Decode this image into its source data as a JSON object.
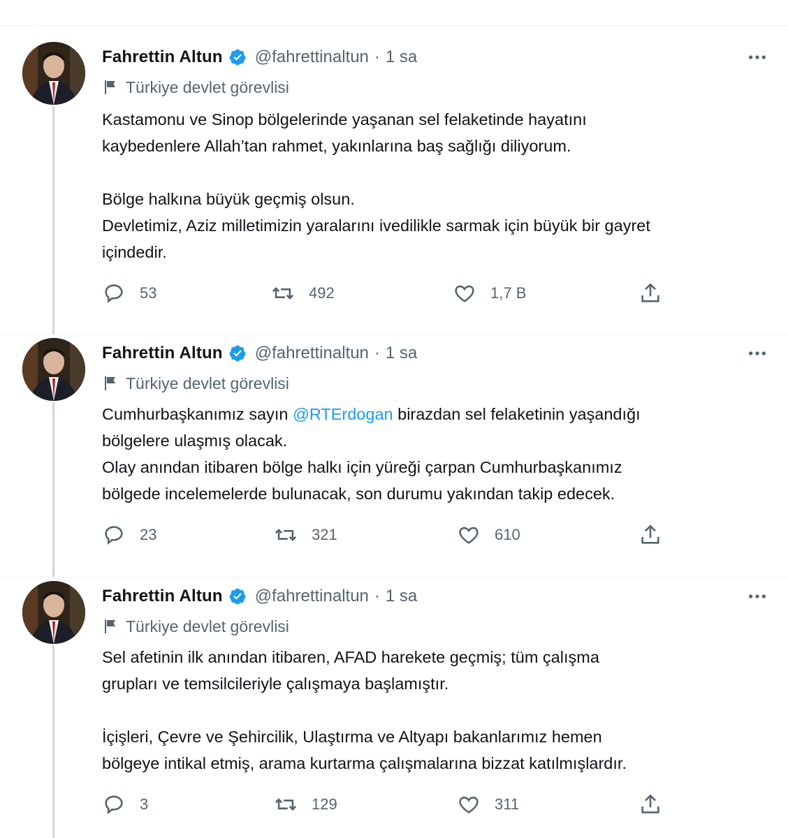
{
  "author": {
    "name": "Fahrettin Altun",
    "handle": "@fahrettinaltun",
    "time": "1 sa",
    "label": "Türkiye devlet görevlisi",
    "verified_color": "#1d9bf0"
  },
  "icons": {
    "reply": "reply-icon",
    "retweet": "retweet-icon",
    "like": "like-icon",
    "share": "share-icon",
    "more": "more-icon",
    "flag": "flag-icon",
    "verified": "verified-badge-icon"
  },
  "tweets": [
    {
      "lines": [
        "Kastamonu ve Sinop bölgelerinde yaşanan sel felaketinde hayatını",
        "kaybedenlere Allah’tan rahmet, yakınlarına baş sağlığı diliyorum.",
        "",
        "Bölge halkına büyük geçmiş olsun.",
        "Devletimiz, Aziz milletimizin yaralarını ivedilikle sarmak için büyük bir gayret",
        "içindedir."
      ],
      "replies": "53",
      "retweets": "492",
      "likes": "1,7 B"
    },
    {
      "line1_before": "Cumhurbaşkanımız sayın ",
      "mention": "@RTErdogan",
      "line1_after": " birazdan sel felaketinin yaşandığı",
      "lines": [
        "bölgelere ulaşmış olacak.",
        "Olay anından itibaren bölge halkı için yüreği çarpan Cumhurbaşkanımız",
        "bölgede incelemelerde bulunacak, son durumu yakından takip edecek."
      ],
      "replies": "23",
      "retweets": "321",
      "likes": "610"
    },
    {
      "lines": [
        "Sel afetinin ilk anından itibaren, AFAD harekete geçmiş; tüm çalışma",
        "grupları ve temsilcileriyle çalışmaya başlamıştır.",
        "",
        "İçişleri, Çevre ve Şehircilik, Ulaştırma ve Altyapı bakanlarımız hemen",
        "bölgeye intikal etmiş, arama kurtarma çalışmalarına bizzat katılmışlardır."
      ],
      "replies": "3",
      "retweets": "129",
      "likes": "311"
    }
  ]
}
